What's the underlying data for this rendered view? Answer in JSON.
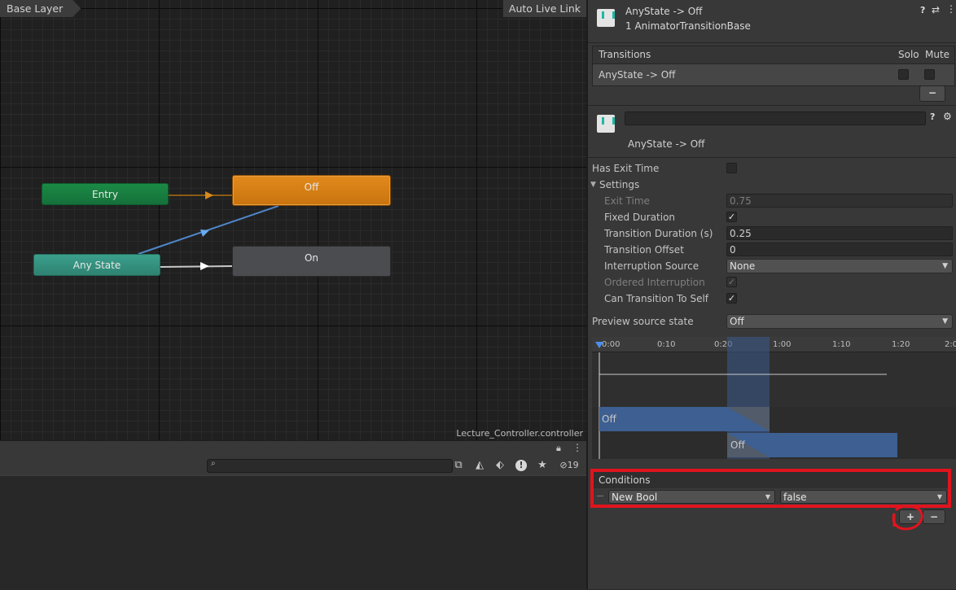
{
  "graph": {
    "breadcrumb": "Base Layer",
    "auto_live_link": "Auto Live Link",
    "controller_name": "Lecture_Controller.controller",
    "nodes": {
      "entry": "Entry",
      "any_state": "Any State",
      "off": "Off",
      "on": "On"
    }
  },
  "parameters_panel": {
    "search_placeholder": "",
    "hidden_count": "19"
  },
  "inspector": {
    "header": {
      "title": "AnyState -> Off",
      "subtitle": "1 AnimatorTransitionBase"
    },
    "transitions_list": {
      "header": "Transitions",
      "solo_label": "Solo",
      "mute_label": "Mute",
      "items": [
        "AnyState -> Off"
      ],
      "remove_label": "−"
    },
    "transition": {
      "name_value": "",
      "subtitle": "AnyState -> Off",
      "has_exit_time_label": "Has Exit Time",
      "has_exit_time": false,
      "settings_label": "Settings",
      "exit_time_label": "Exit Time",
      "exit_time_value": "0.75",
      "fixed_duration_label": "Fixed Duration",
      "fixed_duration": true,
      "transition_duration_label": "Transition Duration (s)",
      "transition_duration_value": "0.25",
      "transition_offset_label": "Transition Offset",
      "transition_offset_value": "0",
      "interruption_source_label": "Interruption Source",
      "interruption_source_value": "None",
      "ordered_interruption_label": "Ordered Interruption",
      "ordered_interruption": true,
      "can_transition_to_self_label": "Can Transition To Self",
      "can_transition_to_self": true,
      "preview_source_state_label": "Preview source state",
      "preview_source_state_value": "Off"
    },
    "timeline": {
      "ticks": [
        "0:00",
        "0:10",
        "0:20",
        "1:00",
        "1:10",
        "1:20",
        "2:0"
      ],
      "source_clip": "Off",
      "dest_clip": "Off"
    },
    "conditions": {
      "header": "Conditions",
      "parameter": "New Bool",
      "value": "false",
      "add_label": "+",
      "remove_label": "−"
    }
  },
  "colors": {
    "entry": "#1b8a45",
    "any_state": "#3aa08c",
    "off_selected": "#e28a1c",
    "on": "#4a4c4f",
    "highlight": "#e0141e"
  }
}
